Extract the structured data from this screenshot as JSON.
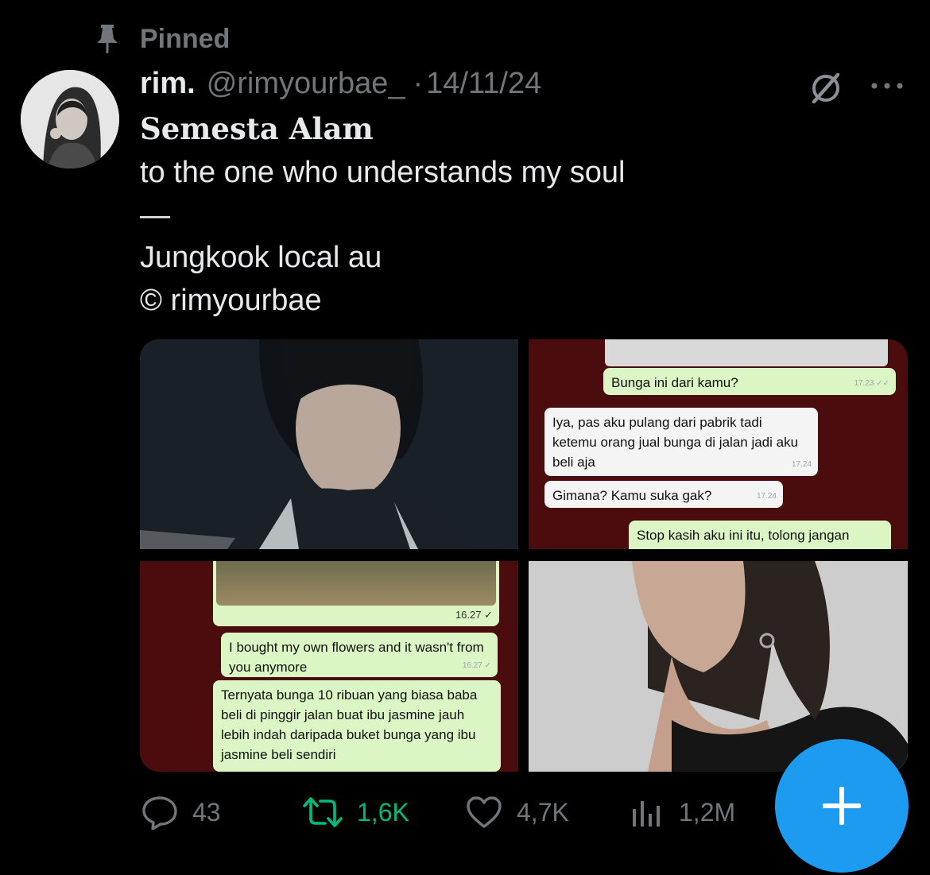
{
  "pinned": {
    "label": "Pinned"
  },
  "tweet": {
    "name": "rim.",
    "handle": "@rimyourbae_",
    "separator": "·",
    "date": "14/11/24",
    "title": "Semesta Alam",
    "lines": [
      "to the one who understands my soul",
      "—",
      "Jungkook local au",
      "© rimyourbae"
    ]
  },
  "media": {
    "chat1": [
      {
        "text": "Bunga ini dari kamu?",
        "time": "17.23 ✓✓"
      },
      {
        "text": "Iya, pas aku pulang dari pabrik tadi ketemu orang jual bunga di jalan jadi aku beli aja",
        "time": "17.24"
      },
      {
        "text": "Gimana? Kamu suka gak?",
        "time": "17.24"
      },
      {
        "text": "Stop kasih aku ini itu, tolong jangan",
        "time": ""
      }
    ],
    "chat2": [
      {
        "text": "",
        "time": "16.27 ✓"
      },
      {
        "text": "I bought my own flowers and it wasn't from you anymore",
        "time": "16.27 ✓"
      },
      {
        "text": "Ternyata bunga 10 ribuan yang biasa baba beli di pinggir jalan buat ibu jasmine jauh lebih indah daripada buket bunga yang ibu jasmine beli sendiri",
        "time": ""
      }
    ]
  },
  "actions": {
    "replies": "43",
    "retweets": "1,6K",
    "likes": "4,7K",
    "views": "1,2M"
  },
  "colors": {
    "accent": "#1d9bf0",
    "retweet": "#00ba7c",
    "muted": "#71767b",
    "background": "#000000"
  }
}
